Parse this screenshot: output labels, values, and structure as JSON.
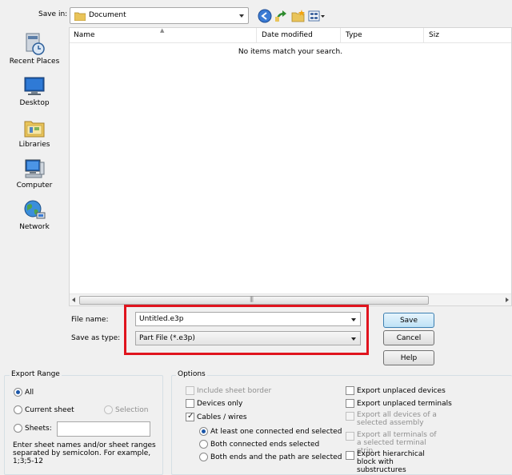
{
  "top": {
    "save_in_label": "Save in:",
    "save_in_value": "Document"
  },
  "places": [
    {
      "label": "Recent Places",
      "icon": "recent-places-icon"
    },
    {
      "label": "Desktop",
      "icon": "desktop-icon"
    },
    {
      "label": "Libraries",
      "icon": "libraries-icon"
    },
    {
      "label": "Computer",
      "icon": "computer-icon"
    },
    {
      "label": "Network",
      "icon": "network-icon"
    }
  ],
  "list": {
    "columns": [
      "Name",
      "Date modified",
      "Type",
      "Siz"
    ],
    "empty_message": "No items match your search."
  },
  "file": {
    "name_label": "File name:",
    "name_value": "Untitled.e3p",
    "type_label": "Save as type:",
    "type_value": "Part File (*.e3p)"
  },
  "buttons": {
    "save": "Save",
    "cancel": "Cancel",
    "help": "Help"
  },
  "export_range": {
    "title": "Export Range",
    "all": "All",
    "current_sheet": "Current sheet",
    "selection": "Selection",
    "sheets": "Sheets:",
    "help_text": "Enter sheet names and/or sheet ranges separated by semicolon. For example, 1;3;5-12"
  },
  "options": {
    "title": "Options",
    "left": [
      {
        "label": "Include sheet border",
        "checked": false,
        "disabled": true
      },
      {
        "label": "Devices only",
        "checked": false,
        "disabled": false
      },
      {
        "label": "Cables / wires",
        "checked": true,
        "disabled": false
      }
    ],
    "radios": [
      {
        "label": "At least one connected end selected",
        "selected": true
      },
      {
        "label": "Both connected ends selected",
        "selected": false
      },
      {
        "label": "Both ends and the path are selected",
        "selected": false
      }
    ],
    "right": [
      {
        "label": "Export unplaced devices",
        "checked": false,
        "disabled": false
      },
      {
        "label": "Export unplaced terminals",
        "checked": false,
        "disabled": false
      },
      {
        "label": "Export all devices of a selected assembly",
        "checked": false,
        "disabled": true
      },
      {
        "label": "Export all terminals of a selected terminal strip",
        "checked": false,
        "disabled": true
      },
      {
        "label": "Export hierarchical block with substructures",
        "checked": false,
        "disabled": false
      }
    ]
  },
  "colors": {
    "highlight": "#e0141e",
    "accent": "#1b56a8"
  }
}
